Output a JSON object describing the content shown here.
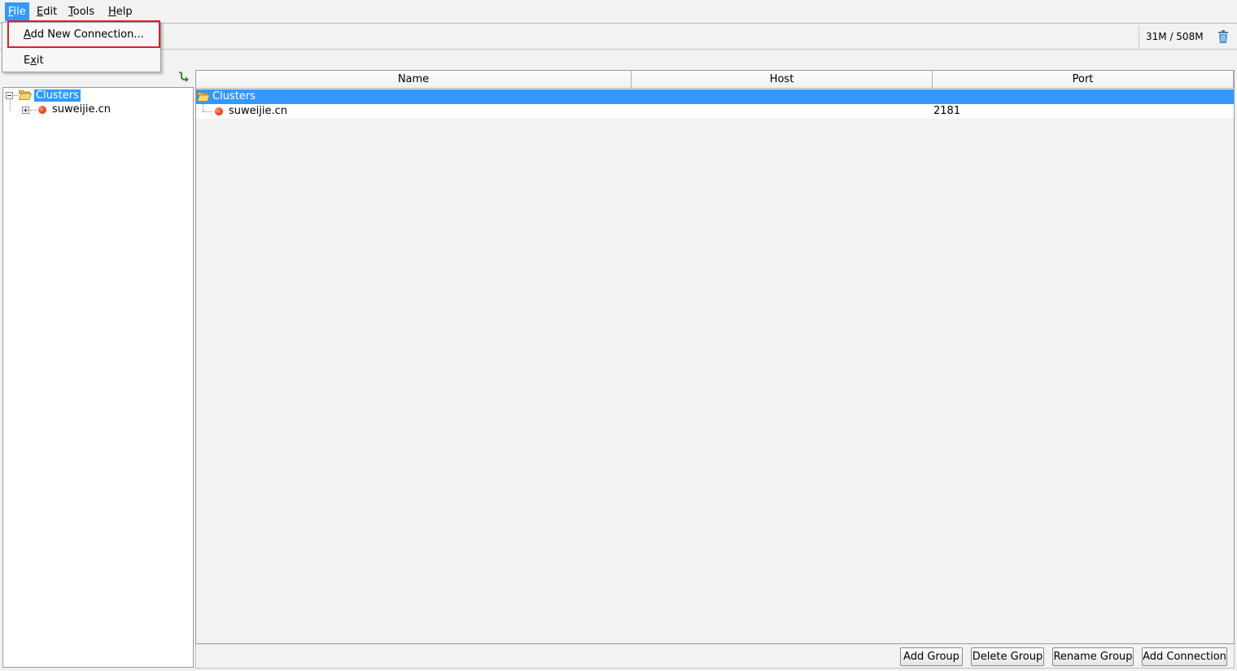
{
  "menubar": {
    "items": [
      {
        "mnemonic": "F",
        "rest": "ile"
      },
      {
        "mnemonic": "E",
        "rest": "dit"
      },
      {
        "mnemonic": "T",
        "rest": "ools"
      },
      {
        "mnemonic": "H",
        "rest": "elp"
      }
    ]
  },
  "file_menu": {
    "items": [
      {
        "mnemonic": "A",
        "rest": "dd New Connection..."
      },
      {
        "pre": "E",
        "mnemonic": "x",
        "rest": "it"
      }
    ]
  },
  "memory": {
    "text": "31M / 508M",
    "icon": "trash-icon"
  },
  "tree": {
    "root_label": "Clusters",
    "child_label": "suweijie.cn"
  },
  "table": {
    "columns": [
      "Name",
      "Host",
      "Port"
    ],
    "rows": [
      {
        "name": "Clusters",
        "host": "",
        "port": ""
      },
      {
        "name": "suweijie.cn",
        "host": "",
        "port": "2181"
      }
    ]
  },
  "buttons": {
    "add_group": "Add Group",
    "delete_group": "Delete Group",
    "rename_group": "Rename Group",
    "add_connection": "Add Connection"
  },
  "colors": {
    "selection": "#3399ff",
    "highlight_box": "#d9222a",
    "node_dot": "#e34a1f"
  }
}
